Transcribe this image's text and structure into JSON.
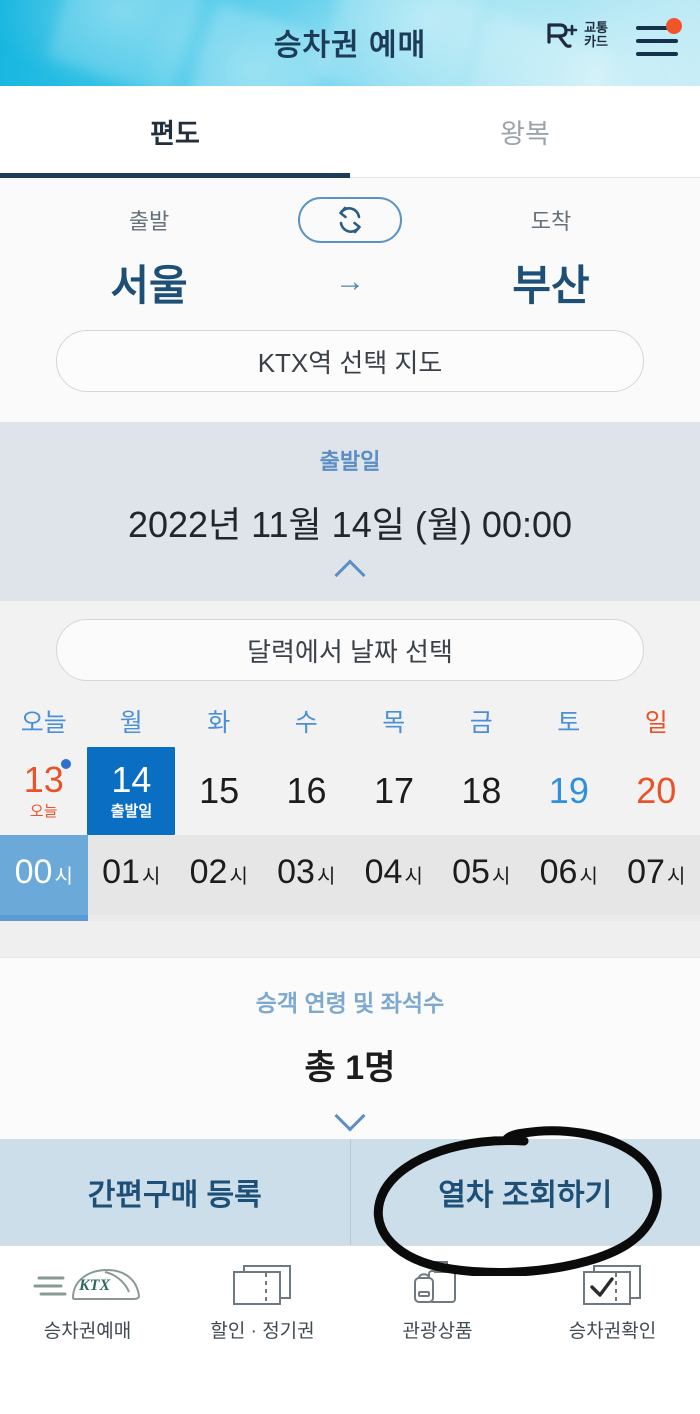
{
  "header": {
    "title": "승차권 예매",
    "card_logo_mark": "R+",
    "card_logo_line1": "교통",
    "card_logo_line2": "카드",
    "menu_icon": "hamburger-menu-icon",
    "notification_dot_color": "#f0552a",
    "background_gradient": [
      "#17b6e0",
      "#36c3e6",
      "#63d0ec",
      "#97e0f1",
      "#bfeaf5"
    ]
  },
  "tabs": [
    {
      "label": "편도",
      "active": true
    },
    {
      "label": "왕복",
      "active": false
    }
  ],
  "route": {
    "departure_label": "출발",
    "arrival_label": "도착",
    "departure_station": "서울",
    "arrival_station": "부산",
    "arrow": "→",
    "swap_icon": "swap-arrows-icon",
    "map_button": "KTX역 선택 지도"
  },
  "depart_date": {
    "label": "출발일",
    "value": "2022년 11월 14일 (월) 00:00",
    "collapse_icon": "chevron-up-icon"
  },
  "calendar": {
    "select_button": "달력에서 날짜 선택",
    "day_headers": [
      {
        "label": "오늘",
        "color": "#4a90d9"
      },
      {
        "label": "월",
        "color": "#4a90d9"
      },
      {
        "label": "화",
        "color": "#4a90d9"
      },
      {
        "label": "수",
        "color": "#4a90d9"
      },
      {
        "label": "목",
        "color": "#4a90d9"
      },
      {
        "label": "금",
        "color": "#4a90d9"
      },
      {
        "label": "토",
        "color": "#4a90d9"
      },
      {
        "label": "일",
        "color": "#e8532a"
      }
    ],
    "dates": [
      {
        "day": "13",
        "sub": "오늘",
        "style": "red",
        "selected": false,
        "dot": true
      },
      {
        "day": "14",
        "sub": "출발일",
        "style": "selected",
        "selected": true,
        "dot": false
      },
      {
        "day": "15",
        "sub": "",
        "style": "normal",
        "selected": false,
        "dot": false
      },
      {
        "day": "16",
        "sub": "",
        "style": "normal",
        "selected": false,
        "dot": false
      },
      {
        "day": "17",
        "sub": "",
        "style": "normal",
        "selected": false,
        "dot": false
      },
      {
        "day": "18",
        "sub": "",
        "style": "normal",
        "selected": false,
        "dot": false
      },
      {
        "day": "19",
        "sub": "",
        "style": "blue",
        "selected": false,
        "dot": false
      },
      {
        "day": "20",
        "sub": "",
        "style": "red",
        "selected": false,
        "dot": false
      }
    ],
    "selected_date_bg": "#0a6fc2"
  },
  "hours": {
    "unit": "시",
    "items": [
      {
        "value": "00",
        "selected": true
      },
      {
        "value": "01",
        "selected": false
      },
      {
        "value": "02",
        "selected": false
      },
      {
        "value": "03",
        "selected": false
      },
      {
        "value": "04",
        "selected": false
      },
      {
        "value": "05",
        "selected": false
      },
      {
        "value": "06",
        "selected": false
      },
      {
        "value": "07",
        "selected": false
      }
    ],
    "selected_bg": "#6aa9d8"
  },
  "passenger": {
    "label": "승객 연령 및 좌석수",
    "value": "총 1명",
    "expand_icon": "chevron-down-icon"
  },
  "actions": {
    "left_label": "간편구매 등록",
    "right_label": "열차 조회하기",
    "annotation": "hand-drawn-circle-highlight",
    "background": "#ccdeea"
  },
  "bottom_nav": [
    {
      "label": "승차권예매",
      "icon": "ktx-train-icon",
      "active": true
    },
    {
      "label": "할인 · 정기권",
      "icon": "tickets-icon",
      "active": false
    },
    {
      "label": "관광상품",
      "icon": "luggage-icon",
      "active": false
    },
    {
      "label": "승차권확인",
      "icon": "ticket-check-icon",
      "active": false
    }
  ]
}
